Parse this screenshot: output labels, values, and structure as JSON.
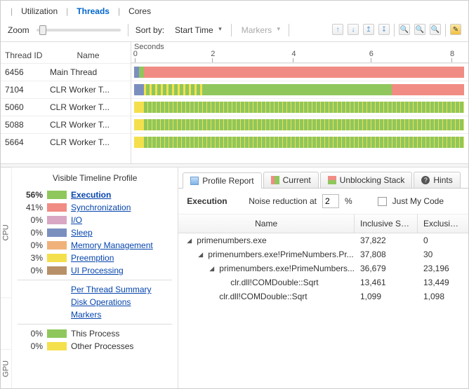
{
  "tabs": {
    "utilization": "Utilization",
    "threads": "Threads",
    "cores": "Cores"
  },
  "toolbar": {
    "zoom": "Zoom",
    "sortby": "Sort by:",
    "sort_value": "Start Time",
    "markers": "Markers"
  },
  "timeline": {
    "seconds": "Seconds",
    "ticks": [
      "0",
      "2",
      "4",
      "6",
      "8"
    ],
    "head_id": "Thread ID",
    "head_name": "Name",
    "threads": [
      {
        "id": "6456",
        "name": "Main Thread"
      },
      {
        "id": "7104",
        "name": "CLR Worker T..."
      },
      {
        "id": "5060",
        "name": "CLR Worker T..."
      },
      {
        "id": "5088",
        "name": "CLR Worker T..."
      },
      {
        "id": "5664",
        "name": "CLR Worker T..."
      }
    ]
  },
  "profile": {
    "title": "Visible Timeline Profile",
    "vlabels": {
      "cpu": "CPU",
      "gpu": "GPU"
    },
    "rows": [
      {
        "pct": "56%",
        "color": "#8fc75d",
        "label": "Execution",
        "bold": true
      },
      {
        "pct": "41%",
        "color": "#f18c84",
        "label": "Synchronization"
      },
      {
        "pct": "0%",
        "color": "#d9a7c3",
        "label": "I/O"
      },
      {
        "pct": "0%",
        "color": "#7b8fbf",
        "label": "Sleep"
      },
      {
        "pct": "0%",
        "color": "#f0b27a",
        "label": "Memory Management"
      },
      {
        "pct": "3%",
        "color": "#f4e04d",
        "label": "Preemption"
      },
      {
        "pct": "0%",
        "color": "#b89068",
        "label": "UI Processing"
      }
    ],
    "links": [
      "Per Thread Summary",
      "Disk Operations",
      "Markers"
    ],
    "gpu": [
      {
        "pct": "0%",
        "color": "#8fc75d",
        "label": "This Process"
      },
      {
        "pct": "0%",
        "color": "#f4e04d",
        "label": "Other Processes"
      }
    ]
  },
  "report": {
    "tabs": {
      "profile": "Profile Report",
      "current": "Current",
      "unblocking": "Unblocking Stack",
      "hints": "Hints"
    },
    "filter_title": "Execution",
    "noise_label": "Noise reduction at",
    "noise_value": "2",
    "pct": "%",
    "just_my_code": "Just My Code",
    "cols": {
      "name": "Name",
      "incl": "Inclusive Sam...",
      "excl": "Exclusive..."
    },
    "rows": [
      {
        "indent": 0,
        "exp": true,
        "name": "primenumbers.exe",
        "incl": "37,822",
        "excl": "0"
      },
      {
        "indent": 1,
        "exp": true,
        "name": "primenumbers.exe!PrimeNumbers.Pr...",
        "incl": "37,808",
        "excl": "30"
      },
      {
        "indent": 2,
        "exp": true,
        "name": "primenumbers.exe!PrimeNumbers...",
        "incl": "36,679",
        "excl": "23,196"
      },
      {
        "indent": 3,
        "exp": false,
        "name": "clr.dll!COMDouble::Sqrt",
        "incl": "13,461",
        "excl": "13,449"
      },
      {
        "indent": 2,
        "exp": false,
        "name": "clr.dll!COMDouble::Sqrt",
        "incl": "1,099",
        "excl": "1,098"
      }
    ]
  }
}
